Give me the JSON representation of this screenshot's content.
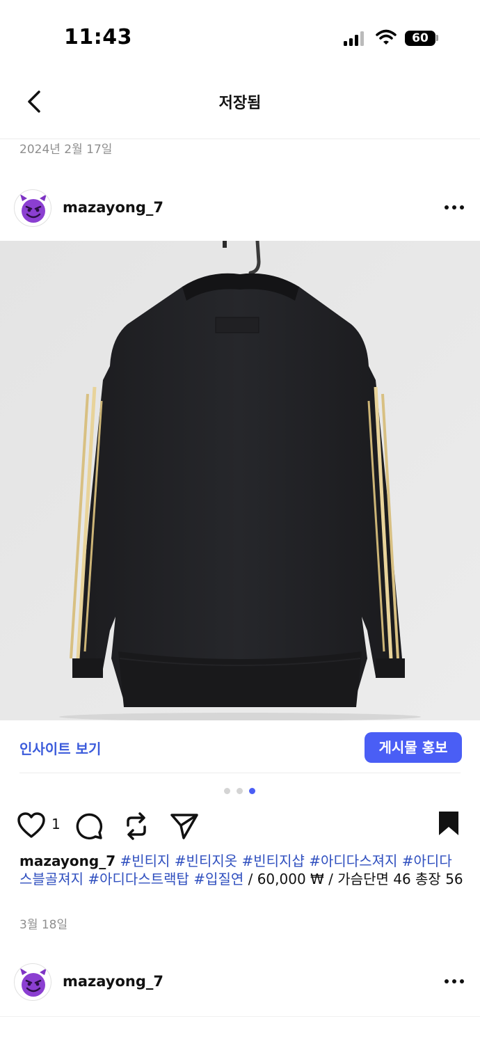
{
  "status_bar": {
    "time": "11:43",
    "battery": "60"
  },
  "nav": {
    "title": "저장됨"
  },
  "date_header": "2024년 2월 17일",
  "post": {
    "username": "mazayong_7",
    "insight_label": "인사이트 보기",
    "promote_label": "게시물 홍보",
    "like_count": "1",
    "caption_user": "mazayong_7",
    "hashtags": [
      "#빈티지",
      "#빈티지옷",
      "#빈티지샵",
      "#아디다스져지",
      "#아디다스블골져지",
      "#아디다스트랙탑",
      "#입질연"
    ],
    "caption_text": " / 60,000 ₩ / 가슴단면 46 총장 56",
    "date": "3월 18일",
    "carousel": {
      "count": 3,
      "active": 3
    }
  },
  "next_post": {
    "username": "mazayong_7"
  },
  "icons": {
    "back": "chevron-left-icon",
    "more": "more-horizontal-icon",
    "like": "heart-outline-icon",
    "comment": "comment-icon",
    "repost": "repost-icon",
    "share": "send-icon",
    "save": "bookmark-filled-icon",
    "avatar": "purple-devil-emoji-icon"
  },
  "colors": {
    "accent": "#4a5ef5",
    "hashtag": "#2f4fbf",
    "muted": "#8e8e8e",
    "avatar": "#8b3fd1"
  }
}
